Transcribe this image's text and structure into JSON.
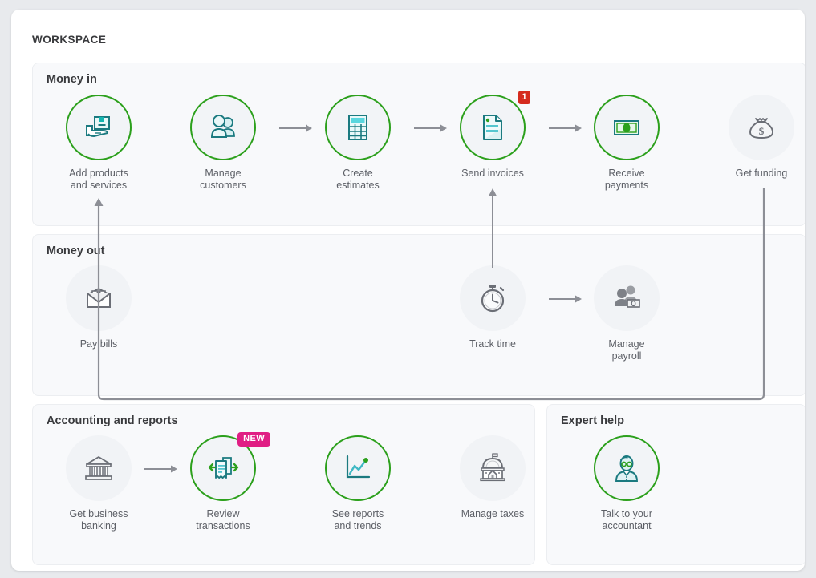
{
  "workspace": {
    "title": "WORKSPACE",
    "colors": {
      "accent_green": "#2ca01c",
      "icon_teal": "#1b7a80",
      "badge_red": "#d52b1e",
      "badge_pink": "#e01e84",
      "muted_gray": "#8d8f96",
      "card_bg": "#f8f9fb",
      "circle_bg": "#f1f3f6",
      "text": "#393a3d",
      "label_text": "#5c5f66"
    }
  },
  "sections": [
    {
      "id": "money-in",
      "title": "Money in",
      "tiles": [
        {
          "id": "add-products-and-services",
          "label": "Add products\nand services",
          "icon": "box-in-hand-icon",
          "active": true,
          "badge": null
        },
        {
          "id": "manage-customers",
          "label": "Manage\ncustomers",
          "icon": "customers-icon",
          "active": true,
          "badge": null
        },
        {
          "id": "create-estimates",
          "label": "Create\nestimates",
          "icon": "estimate-icon",
          "active": true,
          "badge": null
        },
        {
          "id": "send-invoices",
          "label": "Send invoices",
          "icon": "invoice-icon",
          "active": true,
          "badge": "1"
        },
        {
          "id": "receive-payments",
          "label": "Receive\npayments",
          "icon": "banknote-icon",
          "active": true,
          "badge": null
        },
        {
          "id": "get-funding",
          "label": "Get funding",
          "icon": "money-bag-icon",
          "active": false,
          "badge": null
        }
      ]
    },
    {
      "id": "money-out",
      "title": "Money out",
      "tiles": [
        {
          "id": "pay-bills",
          "label": "Pay bills",
          "icon": "envelope-cash-icon",
          "active": false,
          "badge": null
        },
        {
          "id": "track-time",
          "label": "Track time",
          "icon": "stopwatch-icon",
          "active": false,
          "badge": null
        },
        {
          "id": "manage-payroll",
          "label": "Manage\npayroll",
          "icon": "payroll-icon",
          "active": false,
          "badge": null
        }
      ]
    },
    {
      "id": "accounting-and-reports",
      "title": "Accounting and reports",
      "tiles": [
        {
          "id": "get-business-banking",
          "label": "Get business\nbanking",
          "icon": "bank-icon",
          "active": false,
          "badge": null
        },
        {
          "id": "review-transactions",
          "label": "Review\ntransactions",
          "icon": "receipt-swap-icon",
          "active": true,
          "badge": "NEW"
        },
        {
          "id": "see-reports-and-trends",
          "label": "See reports\nand trends",
          "icon": "line-chart-icon",
          "active": true,
          "badge": null
        },
        {
          "id": "manage-taxes",
          "label": "Manage taxes",
          "icon": "capitol-icon",
          "active": false,
          "badge": null
        }
      ]
    },
    {
      "id": "expert-help",
      "title": "Expert help",
      "tiles": [
        {
          "id": "talk-to-your-accountant",
          "label": "Talk to your\naccountant",
          "icon": "accountant-icon",
          "active": true,
          "badge": null
        }
      ]
    }
  ],
  "connectors": [
    {
      "id": "add-products-to-manage-customers",
      "type": "horizontal-arrow"
    },
    {
      "id": "manage-customers-to-create-estimates",
      "type": "horizontal-arrow"
    },
    {
      "id": "create-estimates-to-send-invoices",
      "type": "horizontal-arrow"
    },
    {
      "id": "send-invoices-to-receive-payments",
      "type": "horizontal-arrow"
    },
    {
      "id": "track-time-to-manage-payroll",
      "type": "horizontal-arrow"
    },
    {
      "id": "get-business-banking-to-review-transactions",
      "type": "horizontal-arrow"
    },
    {
      "id": "track-time-to-send-invoices",
      "type": "vertical-arrow-up"
    },
    {
      "id": "get-funding-to-pay-bills",
      "type": "elbow-arrow-up"
    }
  ]
}
